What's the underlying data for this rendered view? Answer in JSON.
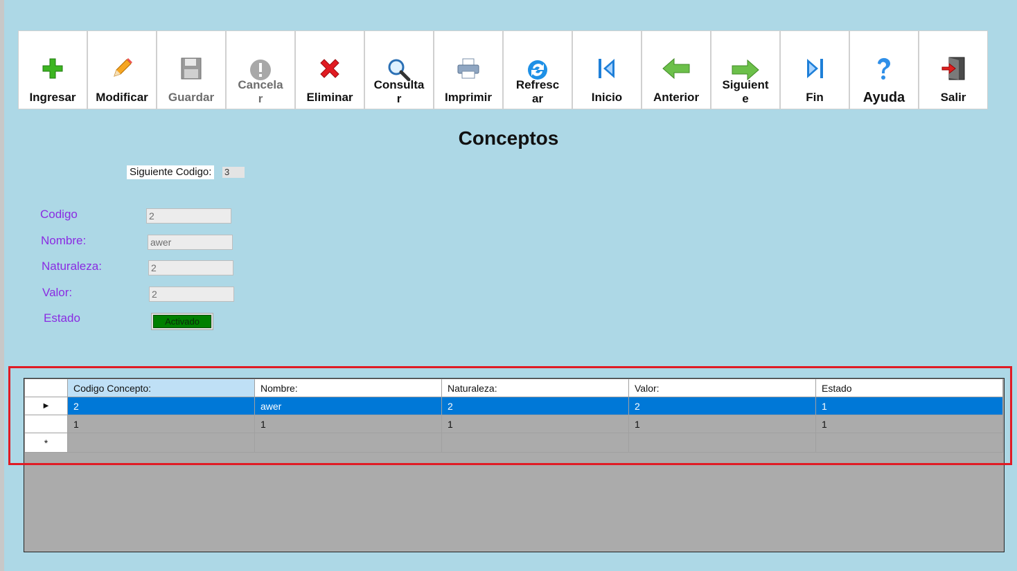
{
  "toolbar": {
    "buttons": [
      {
        "label": "Ingresar",
        "icon": "plus-icon",
        "enabled": true
      },
      {
        "label": "Modificar",
        "icon": "pencil-icon",
        "enabled": true
      },
      {
        "label": "Guardar",
        "icon": "floppy-disk-icon",
        "enabled": false
      },
      {
        "label": "Cancelar",
        "icon": "cancel-icon",
        "enabled": false
      },
      {
        "label": "Eliminar",
        "icon": "red-x-icon",
        "enabled": true
      },
      {
        "label": "Consultar",
        "icon": "magnifier-icon",
        "enabled": true
      },
      {
        "label": "Imprimir",
        "icon": "printer-icon",
        "enabled": true
      },
      {
        "label": "Refrescar",
        "icon": "refresh-icon",
        "enabled": true
      },
      {
        "label": "Inicio",
        "icon": "first-record-icon",
        "enabled": true
      },
      {
        "label": "Anterior",
        "icon": "arrow-left-icon",
        "enabled": true
      },
      {
        "label": "Siguiente",
        "icon": "arrow-right-icon",
        "enabled": true
      },
      {
        "label": "Fin",
        "icon": "last-record-icon",
        "enabled": true
      },
      {
        "label": "Ayuda",
        "icon": "help-icon",
        "enabled": true
      },
      {
        "label": "Salir",
        "icon": "exit-door-icon",
        "enabled": true
      }
    ]
  },
  "page": {
    "title": "Conceptos"
  },
  "next_code": {
    "label": "Siguiente Codigo:",
    "value": "3"
  },
  "form": {
    "codigo": {
      "label": "Codigo",
      "value": "2"
    },
    "nombre": {
      "label": "Nombre:",
      "value": "awer"
    },
    "naturaleza": {
      "label": "Naturaleza:",
      "value": "2"
    },
    "valor": {
      "label": "Valor:",
      "value": "2"
    },
    "estado": {
      "label": "Estado",
      "value": "Activado"
    }
  },
  "grid": {
    "columns": [
      "Codigo Concepto:",
      "Nombre:",
      "Naturaleza:",
      "Valor:",
      "Estado"
    ],
    "rows": [
      [
        "2",
        "awer",
        "2",
        "2",
        "1"
      ],
      [
        "1",
        "1",
        "1",
        "1",
        "1"
      ]
    ],
    "selected_row_index": 0,
    "current_row_marker": "▶",
    "new_row_marker": "*"
  },
  "colors": {
    "background": "#add8e6",
    "label_purple": "#8a2be2",
    "selection_blue": "#0078d7",
    "highlight_red": "#e01b24",
    "status_green": "#008000"
  }
}
